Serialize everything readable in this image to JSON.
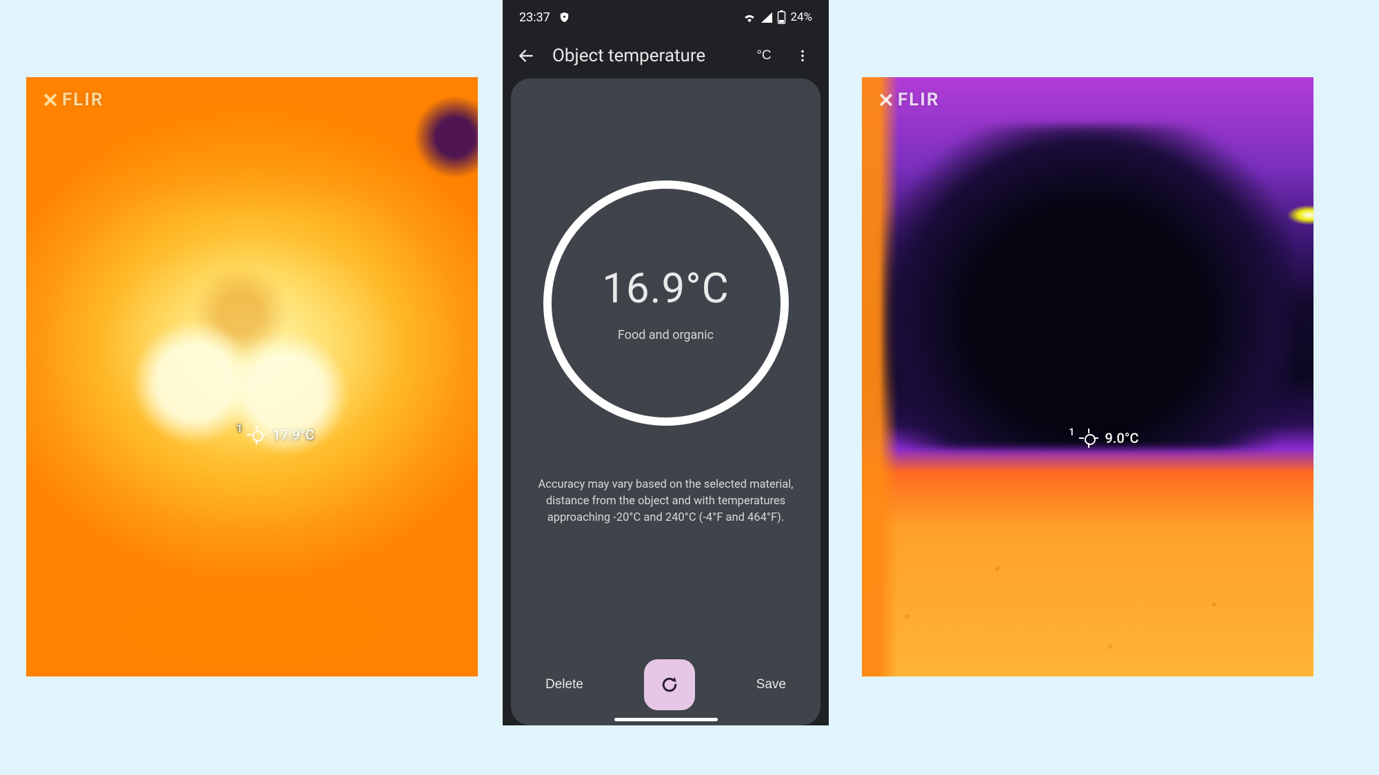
{
  "left_thermal": {
    "brand": "FLIR",
    "spot_index": "1",
    "spot_reading": "17.9°C"
  },
  "right_thermal": {
    "brand": "FLIR",
    "spot_index": "1",
    "spot_reading": "9.0°C"
  },
  "phone": {
    "status": {
      "time": "23:37",
      "battery_text": "24%"
    },
    "appbar": {
      "title": "Object temperature",
      "unit_label": "°C"
    },
    "reading": {
      "value": "16.9°C",
      "material": "Food and organic"
    },
    "disclaimer": "Accuracy may vary based on the selected material, distance from the object and with temperatures approaching -20°C and 240°C (-4°F and 464°F).",
    "actions": {
      "delete": "Delete",
      "save": "Save"
    }
  }
}
